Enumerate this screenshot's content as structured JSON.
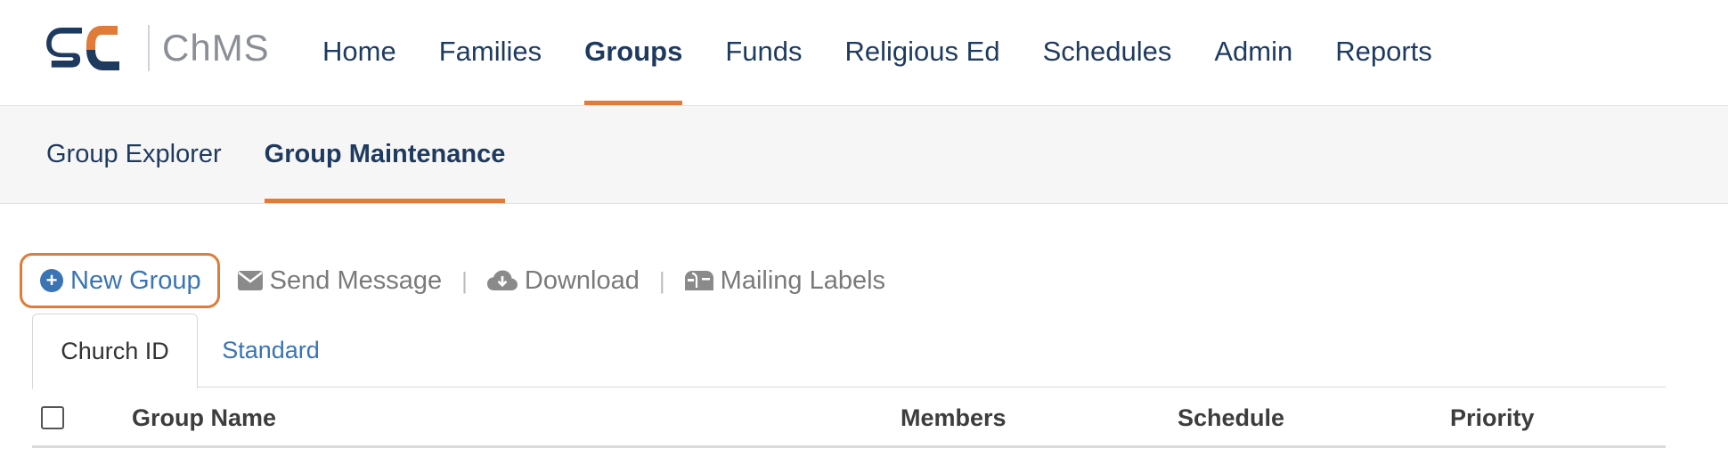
{
  "app": {
    "brand_text": "ChMS",
    "logo_colors": {
      "primary": "#1f3a5f",
      "accent": "#e07b39"
    }
  },
  "nav": {
    "items": [
      {
        "label": "Home"
      },
      {
        "label": "Families"
      },
      {
        "label": "Groups"
      },
      {
        "label": "Funds"
      },
      {
        "label": "Religious Ed"
      },
      {
        "label": "Schedules"
      },
      {
        "label": "Admin"
      },
      {
        "label": "Reports"
      }
    ],
    "active": "Groups"
  },
  "subnav": {
    "items": [
      {
        "label": "Group Explorer"
      },
      {
        "label": "Group Maintenance"
      }
    ],
    "active": "Group Maintenance"
  },
  "actions": {
    "new_group": {
      "label": "New Group",
      "icon": "plus-circle-icon"
    },
    "send_message": {
      "label": "Send Message",
      "icon": "envelope-icon"
    },
    "download": {
      "label": "Download",
      "icon": "cloud-download-icon"
    },
    "mailing_labels": {
      "label": "Mailing Labels",
      "icon": "mailbox-icon"
    },
    "separator": "|"
  },
  "tabs": {
    "items": [
      {
        "label": "Church ID"
      },
      {
        "label": "Standard"
      }
    ],
    "active": "Church ID"
  },
  "table": {
    "columns": [
      "Group Name",
      "Members",
      "Schedule",
      "Priority"
    ]
  },
  "colors": {
    "accent": "#e07b39",
    "link": "#3a74b4",
    "nav_text": "#1f3a5f"
  }
}
